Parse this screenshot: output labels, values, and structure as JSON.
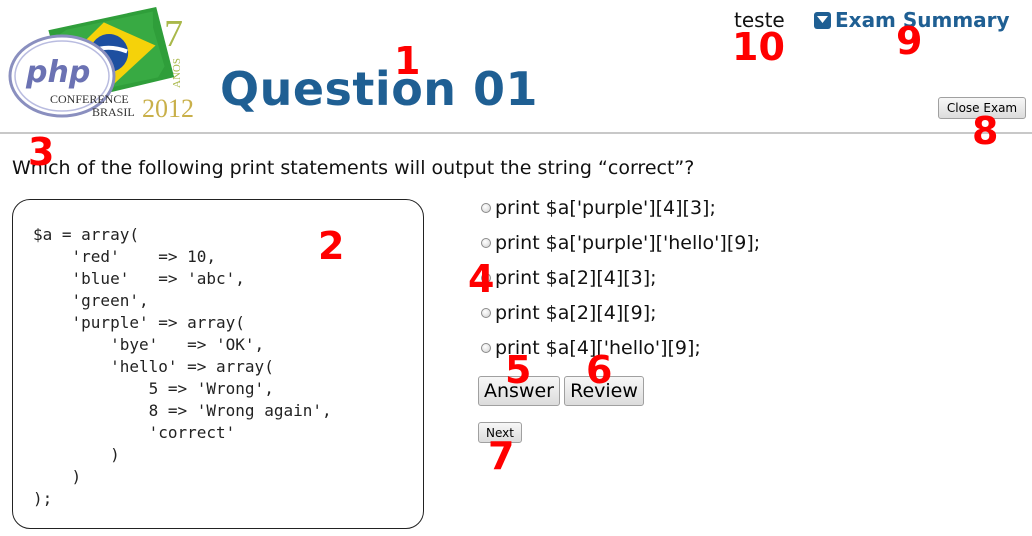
{
  "logo": {
    "brand": "php",
    "line1": "CONFERENCE",
    "line2": "BRASIL",
    "year": "2012",
    "edition_number": "7",
    "edition_word": "ANOS"
  },
  "header": {
    "title": "Question 01",
    "user_name": "teste",
    "summary_label": "Exam Summary",
    "close_label": "Close Exam"
  },
  "question": {
    "text": "Which of the following print statements will output the string “correct”?",
    "code": "$a = array(\n    'red'    => 10,\n    'blue'   => 'abc',\n    'green',\n    'purple' => array(\n        'bye'   => 'OK',\n        'hello' => array(\n            5 => 'Wrong',\n            8 => 'Wrong again',\n            'correct'\n        )\n    )\n);"
  },
  "options": [
    "print $a['purple'][4][3];",
    "print $a['purple']['hello'][9];",
    "print $a[2][4][3];",
    "print $a[2][4][9];",
    "print $a[4]['hello'][9];"
  ],
  "actions": {
    "answer_label": "Answer",
    "review_label": "Review",
    "next_label": "Next"
  },
  "markers": [
    "1",
    "2",
    "3",
    "4",
    "5",
    "6",
    "7",
    "8",
    "9",
    "10"
  ],
  "colors": {
    "title_blue": "#1f5f93",
    "marker_red": "#ff0000",
    "brazil_green": "#2f9e3a",
    "brazil_yellow": "#f5d20a",
    "brazil_blue": "#1d4fa0"
  }
}
